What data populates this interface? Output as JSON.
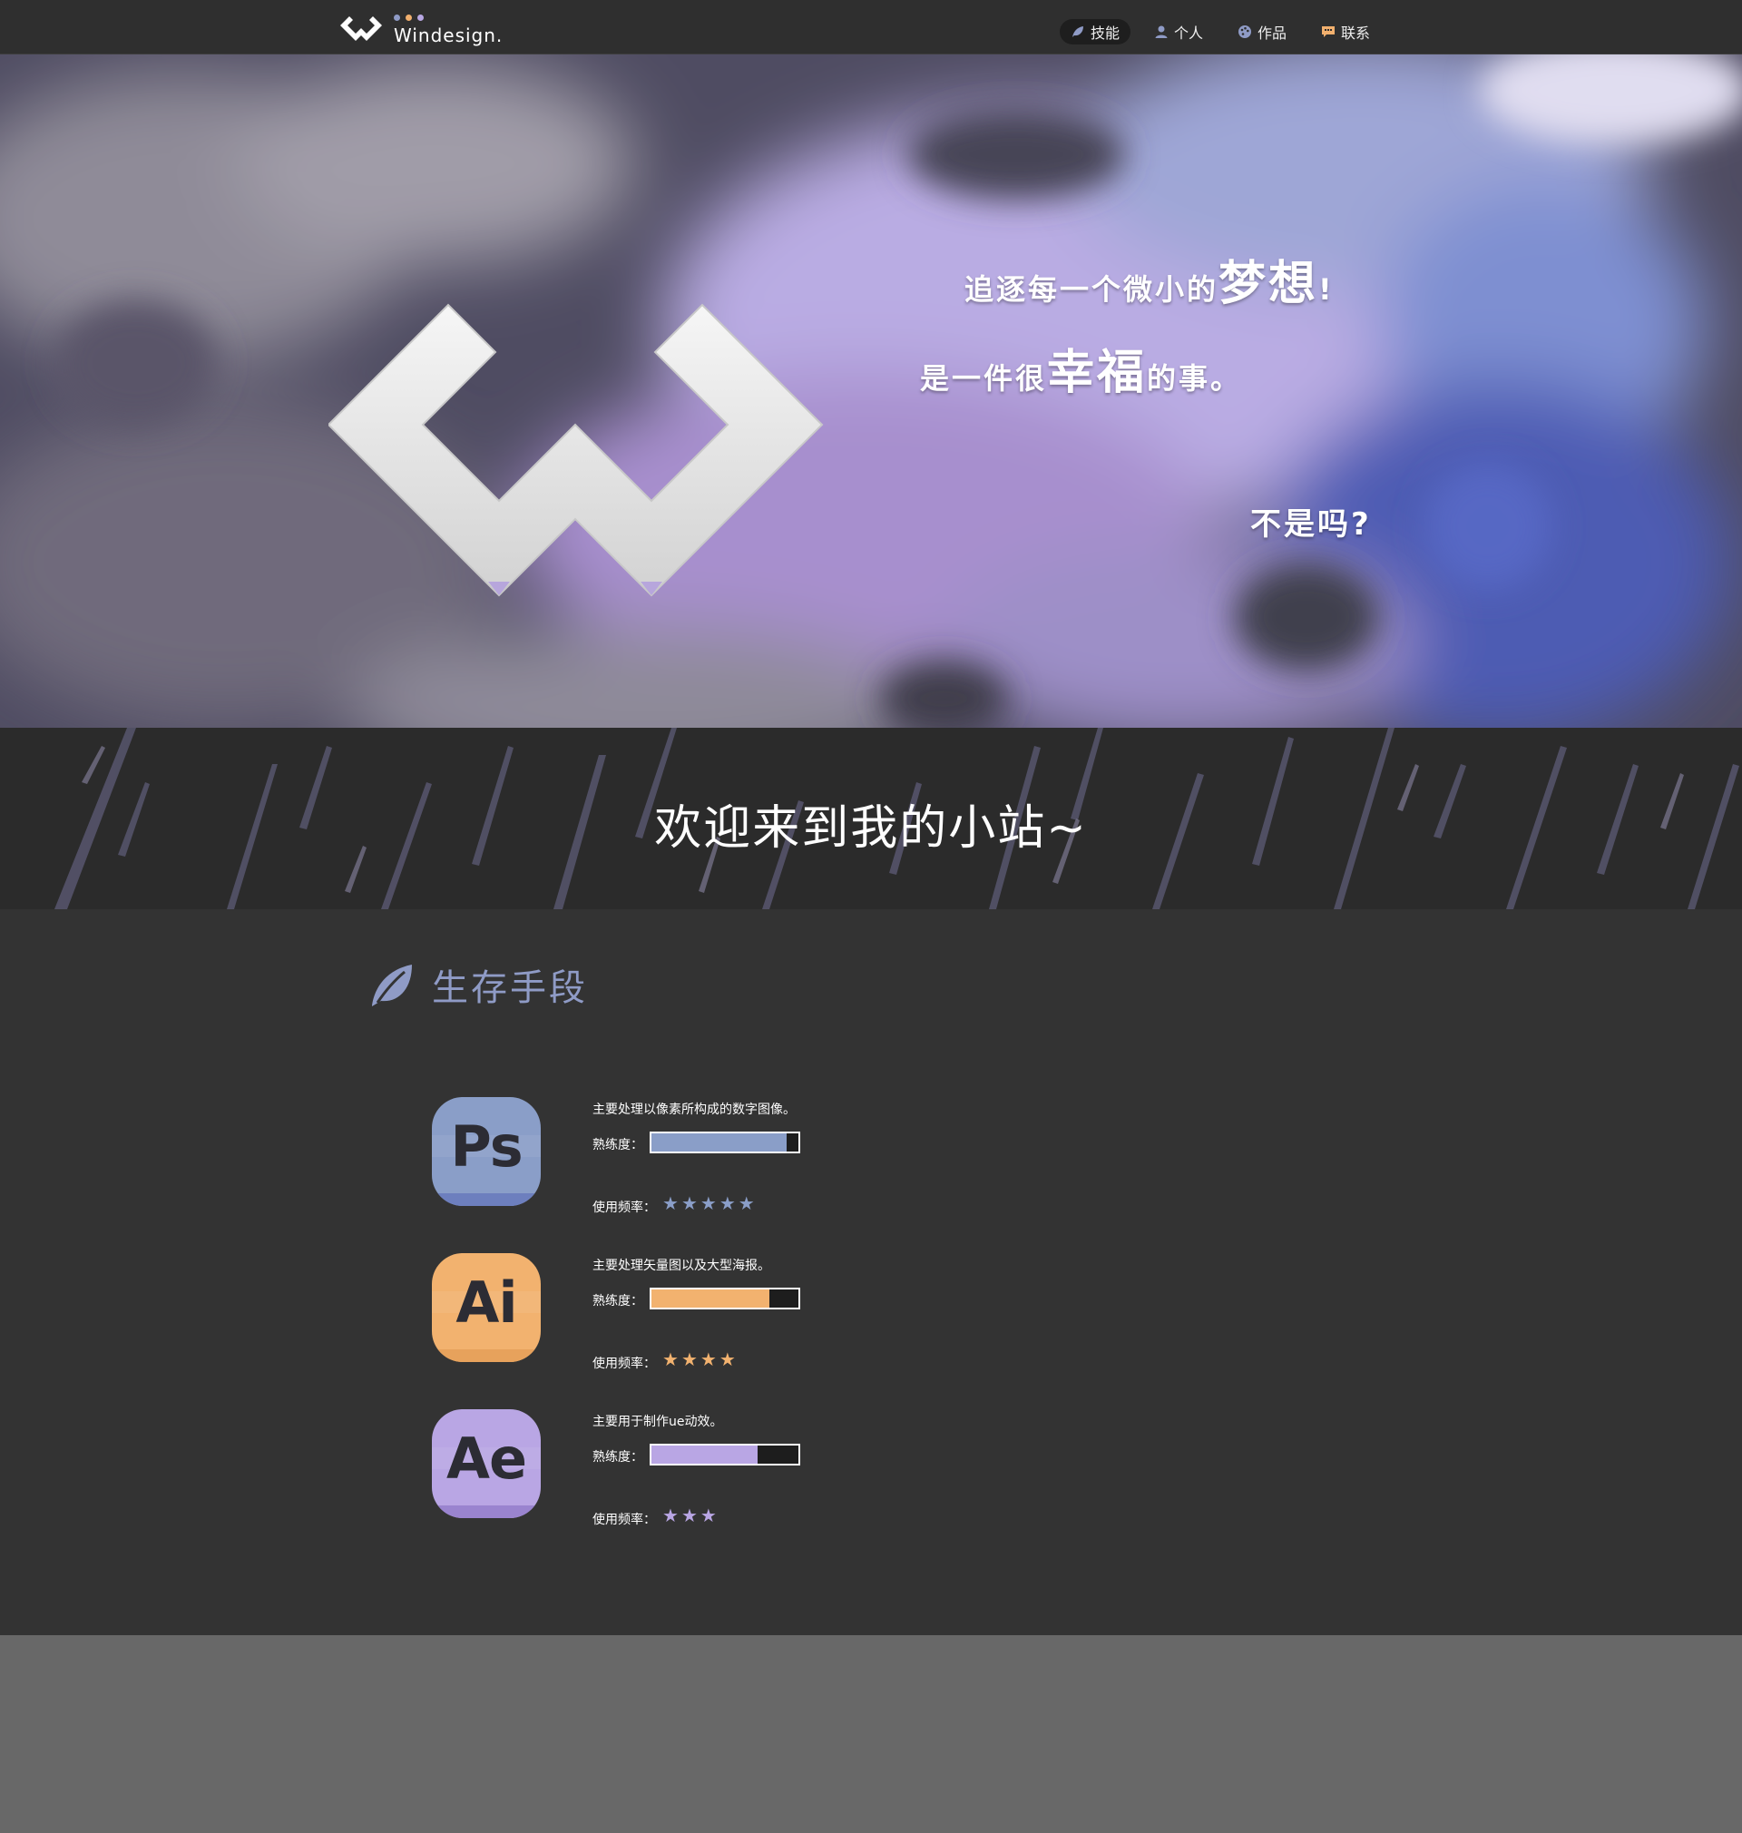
{
  "header": {
    "brand": "Windesign.",
    "brand_dots": [
      "#8f9bc6",
      "#f2b06e",
      "#b8a7e3"
    ],
    "nav": [
      {
        "label": "技能",
        "icon": "leaf-icon",
        "active": true
      },
      {
        "label": "个人",
        "icon": "user-icon",
        "active": false
      },
      {
        "label": "作品",
        "icon": "palette-icon",
        "active": false
      },
      {
        "label": "联系",
        "icon": "chat-icon",
        "active": false
      }
    ]
  },
  "hero": {
    "line1_prefix": "追逐每一个微小的",
    "line1_big": "梦想",
    "line1_suffix": "!",
    "line2_prefix": "是一件很",
    "line2_big": "幸福",
    "line2_suffix": "的事。",
    "line3": "不是吗?"
  },
  "welcome": {
    "text": "欢迎来到我的小站~"
  },
  "skills": {
    "title": "生存手段",
    "title_icon": "leaf-icon",
    "items": [
      {
        "abbr": "Ps",
        "description": "主要处理以像素所构成的数字图像。",
        "proficiency_label": "熟练度：",
        "proficiency": 0.92,
        "frequency_label": "使用频率：",
        "frequency_stars": 5,
        "color": "#8a9ec8",
        "shade": "#6d7fbe"
      },
      {
        "abbr": "Ai",
        "description": "主要处理矢量图以及大型海报。",
        "proficiency_label": "熟练度：",
        "proficiency": 0.8,
        "frequency_label": "使用频率：",
        "frequency_stars": 4,
        "color": "#f2b26f",
        "shade": "#e7a25c"
      },
      {
        "abbr": "Ae",
        "description": "主要用于制作ue动效。",
        "proficiency_label": "熟练度：",
        "proficiency": 0.72,
        "frequency_label": "使用频率：",
        "frequency_stars": 3,
        "color": "#b9a6e4",
        "shade": "#9a84cf"
      }
    ]
  }
}
